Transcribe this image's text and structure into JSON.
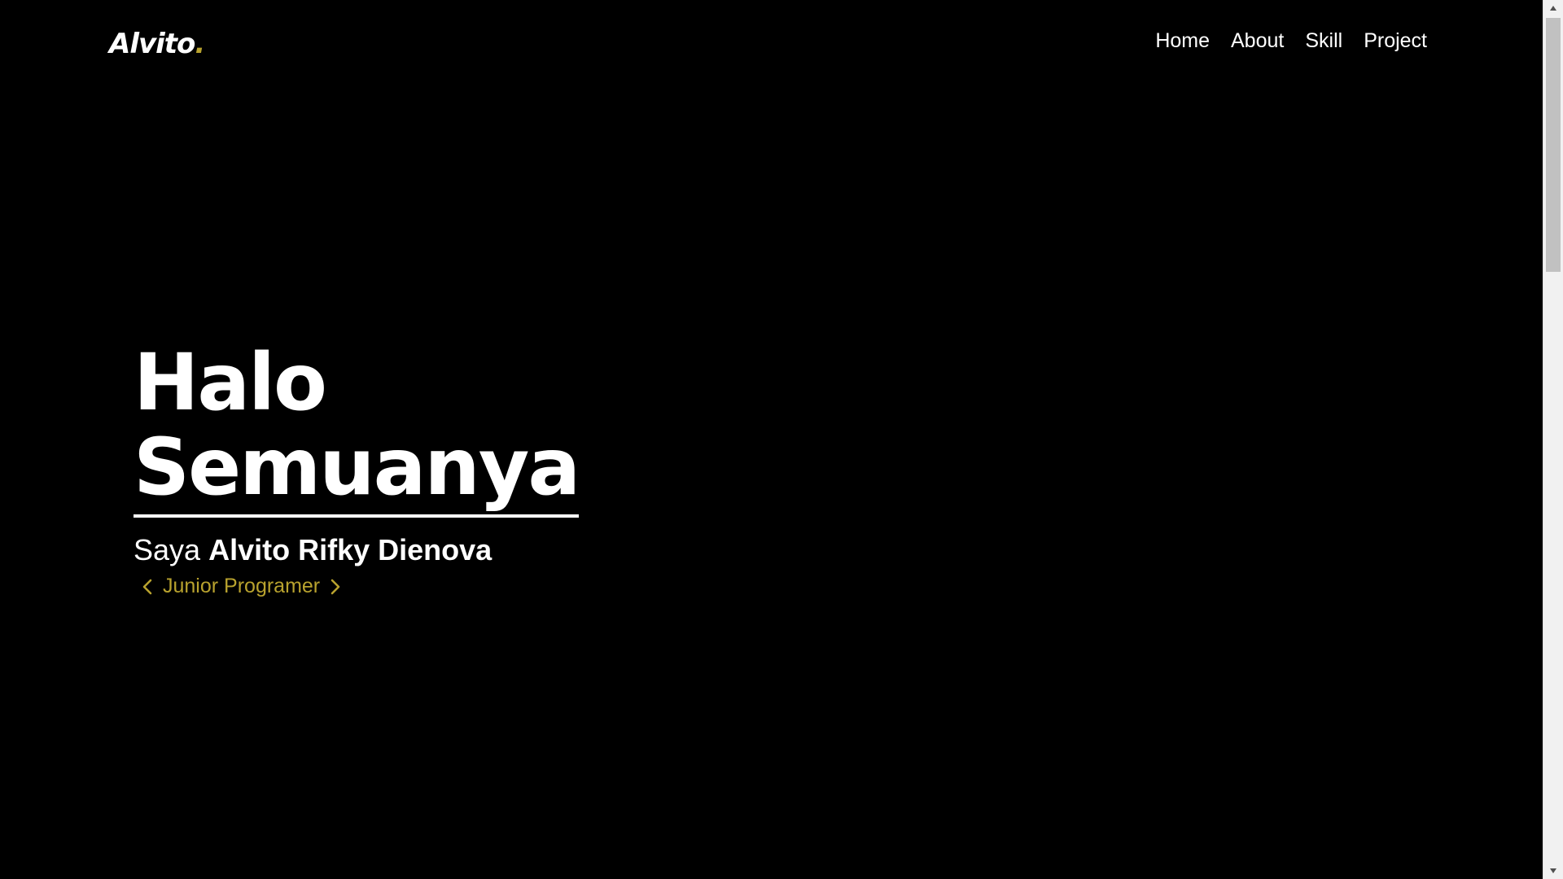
{
  "navbar": {
    "brand": {
      "text": "Alvito",
      "dot": "."
    },
    "links": [
      {
        "label": "Home"
      },
      {
        "label": "About"
      },
      {
        "label": "Skill"
      },
      {
        "label": "Project"
      }
    ]
  },
  "hero": {
    "title_line_1": "Halo",
    "title_line_2": "Semuanya",
    "intro_prefix": "Saya",
    "intro_name": "Alvito Rifky Dienova",
    "role": "Junior Programer"
  },
  "colors": {
    "background": "#000000",
    "text": "#ffffff",
    "accent": "#b8a22e",
    "scrollbar_track": "#f1f1f1",
    "scrollbar_thumb": "#c1c1c1"
  },
  "icons": {
    "role_left": "chevron-left-icon",
    "role_right": "chevron-right-icon",
    "scroll_up": "scroll-up-arrow-icon",
    "scroll_down": "scroll-down-arrow-icon"
  }
}
